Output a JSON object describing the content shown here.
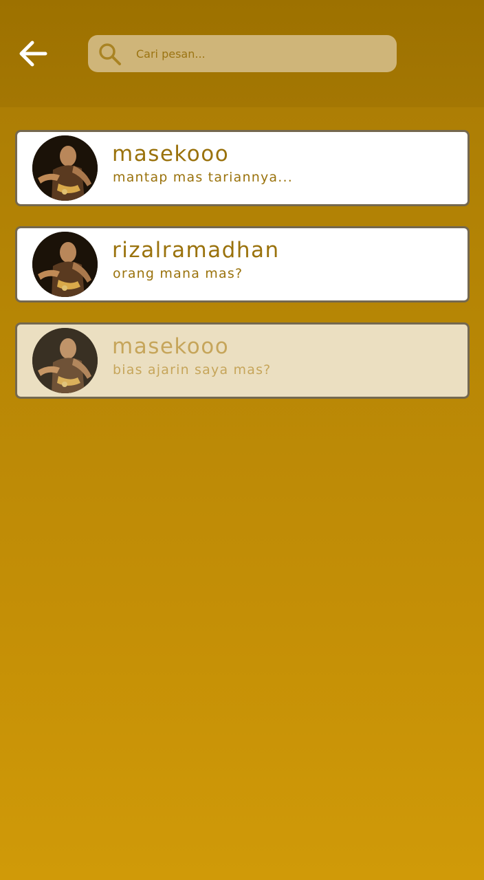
{
  "header": {
    "back_icon": "arrow-left-icon",
    "search": {
      "icon": "search-icon",
      "placeholder": "Cari pesan...",
      "value": ""
    }
  },
  "chats": [
    {
      "name": "masekooo",
      "preview": "mantap mas tariannya...",
      "avatar": "dancer-photo"
    },
    {
      "name": "rizalramadhan",
      "preview": "orang mana mas?",
      "avatar": "dancer-photo"
    },
    {
      "name": "masekooo",
      "preview": "bias ajarin saya mas?",
      "avatar": "dancer-photo",
      "selected": true
    }
  ],
  "colors": {
    "header_bg": "#9d7100",
    "body_bg_top": "#a87a05",
    "body_bg_bottom": "#d09a08",
    "search_bg": "#cfb579",
    "card_bg": "#ffffff",
    "card_selected_bg": "#ebdfc1",
    "card_border": "#74684f",
    "text_accent": "#9a720c"
  }
}
